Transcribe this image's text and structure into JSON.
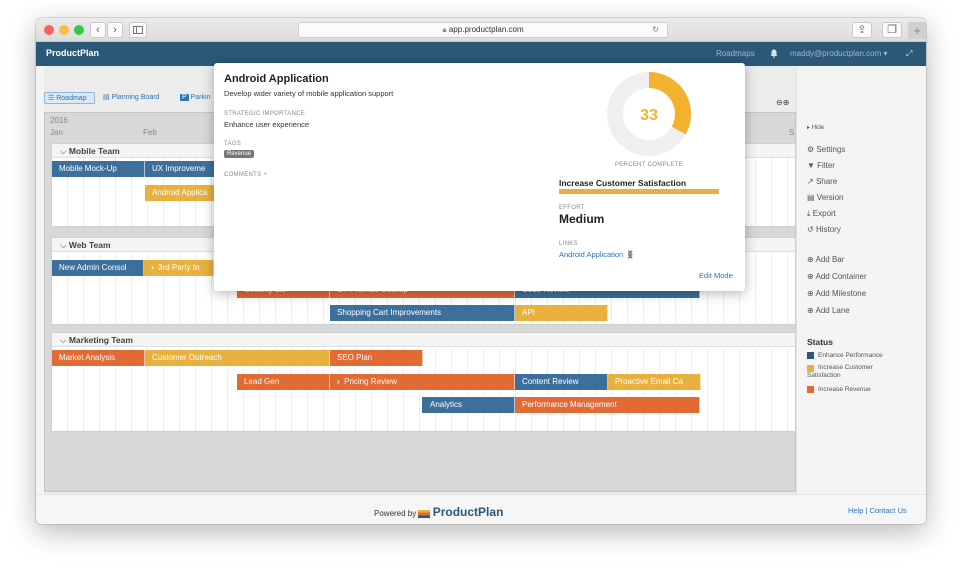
{
  "browser": {
    "url": "app.productplan.com",
    "back_icon": "chevron-left-icon",
    "forward_icon": "chevron-right-icon",
    "sidebar_icon": "sidebar-icon",
    "reload_icon": "reload-icon",
    "share_icon": "share-icon",
    "tabs_icon": "tabs-icon",
    "new_tab_label": "+"
  },
  "appbar": {
    "brand": "ProductPlan",
    "roadmaps": "Roadmaps",
    "user": "maddy@productplan.com ▾",
    "bell_icon": "bell-icon",
    "expand_icon": "expand-icon"
  },
  "views": {
    "roadmap": "Roadmap",
    "planning": "Planning Board",
    "parking": "Parkin"
  },
  "timeline": {
    "year": "2016",
    "months": [
      "Jan",
      "Feb",
      "S"
    ]
  },
  "lanes": {
    "mobile": {
      "title": "Mobile Team",
      "bars": [
        "Mobile Mock-Up",
        "UX Improveme",
        "Android Applica"
      ]
    },
    "web": {
      "title": "Web Team",
      "bars": [
        "New Admin Consol",
        "3rd Party In",
        "Security 2.0",
        "On Premise Backup",
        "Code Review",
        "Shopping Cart Improvements",
        "API"
      ]
    },
    "marketing": {
      "title": "Marketing Team",
      "bars": [
        "Market Analysis",
        "Customer Outreach",
        "SEO Plan",
        "Lead Gen",
        "Pricing Review",
        "Content Review",
        "Proactive Email Ca",
        "Analytics",
        "Performance Management"
      ]
    }
  },
  "sidebar": {
    "hide": "Hide",
    "items": [
      "Settings",
      "Filter",
      "Share",
      "Version",
      "Export",
      "History"
    ],
    "add_items": [
      "Add Bar",
      "Add Container",
      "Add Milestone",
      "Add Lane"
    ],
    "status_title": "Status",
    "legend": [
      {
        "label": "Enhance Performance",
        "color": "#2c5878"
      },
      {
        "label": "Increase Customer Satisfaction",
        "color": "#e8b13d"
      },
      {
        "label": "Increase Revenue",
        "color": "#e16a35"
      }
    ]
  },
  "popup": {
    "title": "Android Application",
    "description": "Develop wider variety of mobile application support",
    "strategic_label": "STRATEGIC IMPORTANCE",
    "strategic_value": "Enhance user experience",
    "tags_label": "TAGS",
    "tag": "Revenue",
    "comments_label": "COMMENTS +",
    "percent_complete": 33,
    "percent_label": "PERCENT COMPLETE",
    "status_value": "Increase Customer Satisfaction",
    "effort_label": "EFFORT",
    "effort_value": "Medium",
    "links_label": "LINKS",
    "link": "Android Application",
    "edit_mode": "Edit Mode"
  },
  "footer": {
    "powered_by": "Powered by",
    "brand": "ProductPlan",
    "help": "Help | Contact Us"
  }
}
